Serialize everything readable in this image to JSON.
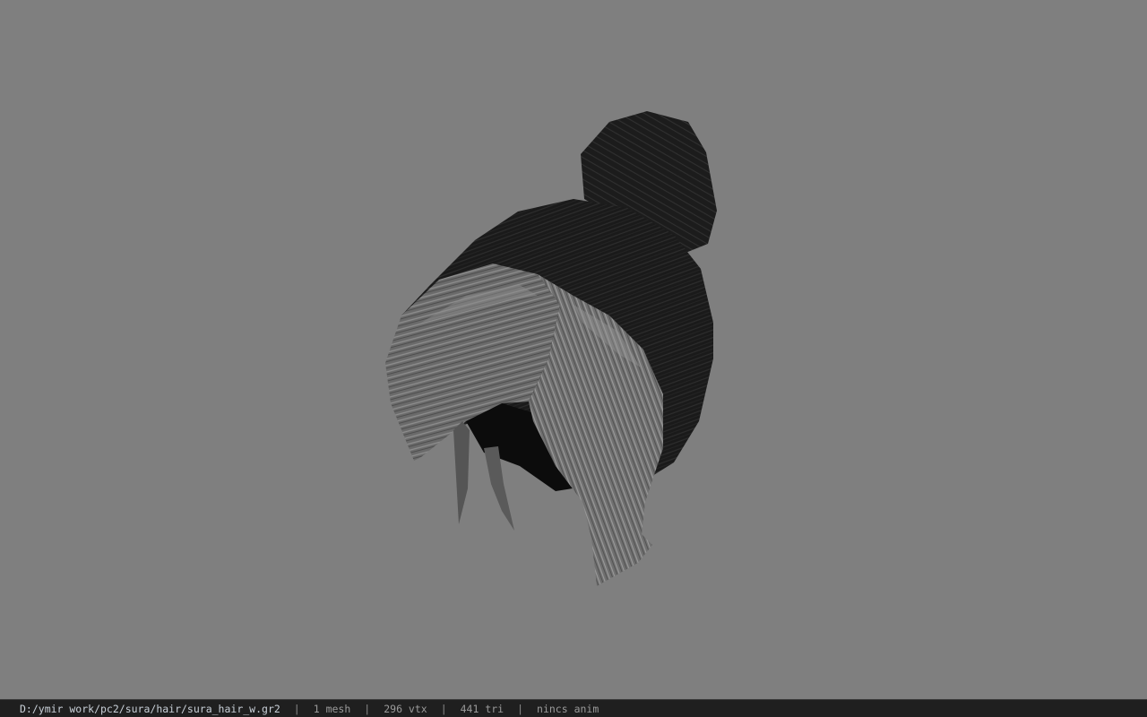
{
  "viewport": {
    "background": "#7f7f7f",
    "model": "hair-mesh"
  },
  "status_bar": {
    "file_path": "D:/ymir work/pc2/sura/hair/sura_hair_w.gr2",
    "separator": "|",
    "mesh_count": "1 mesh",
    "vertex_count": "296 vtx",
    "triangle_count": "441 tri",
    "animation": "nincs anim"
  }
}
